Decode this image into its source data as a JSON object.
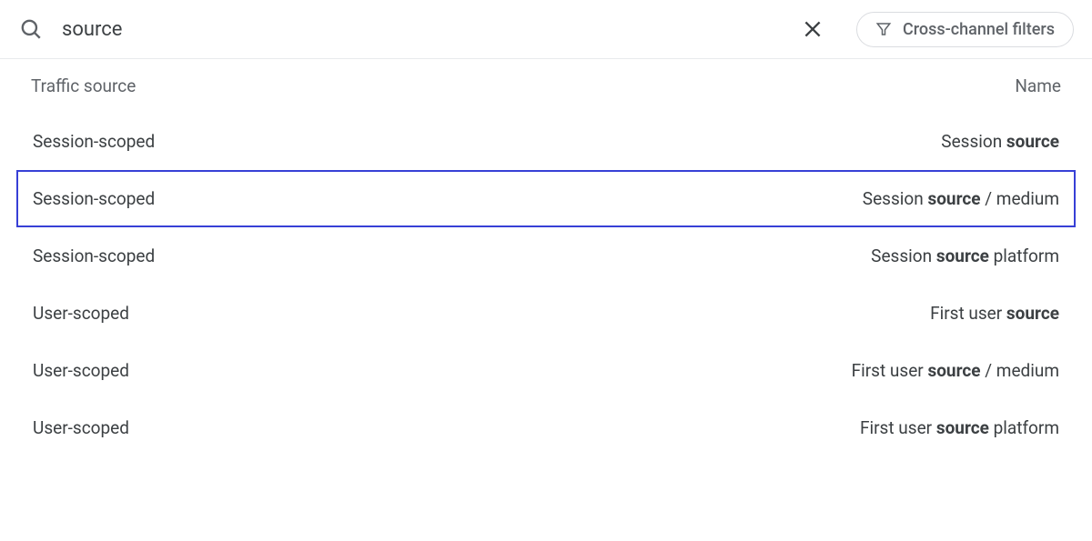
{
  "search": {
    "value": "source"
  },
  "filter_chip": {
    "label": "Cross-channel filters"
  },
  "header": {
    "left": "Traffic source",
    "right": "Name"
  },
  "items": [
    {
      "scope": "Session-scoped",
      "name_prefix": "Session ",
      "name_match": "source",
      "name_suffix": "",
      "highlighted": false
    },
    {
      "scope": "Session-scoped",
      "name_prefix": "Session ",
      "name_match": "source",
      "name_suffix": " / medium",
      "highlighted": true
    },
    {
      "scope": "Session-scoped",
      "name_prefix": "Session ",
      "name_match": "source",
      "name_suffix": " platform",
      "highlighted": false
    },
    {
      "scope": "User-scoped",
      "name_prefix": "First user ",
      "name_match": "source",
      "name_suffix": "",
      "highlighted": false
    },
    {
      "scope": "User-scoped",
      "name_prefix": "First user ",
      "name_match": "source",
      "name_suffix": " / medium",
      "highlighted": false
    },
    {
      "scope": "User-scoped",
      "name_prefix": "First user ",
      "name_match": "source",
      "name_suffix": " platform",
      "highlighted": false
    }
  ]
}
